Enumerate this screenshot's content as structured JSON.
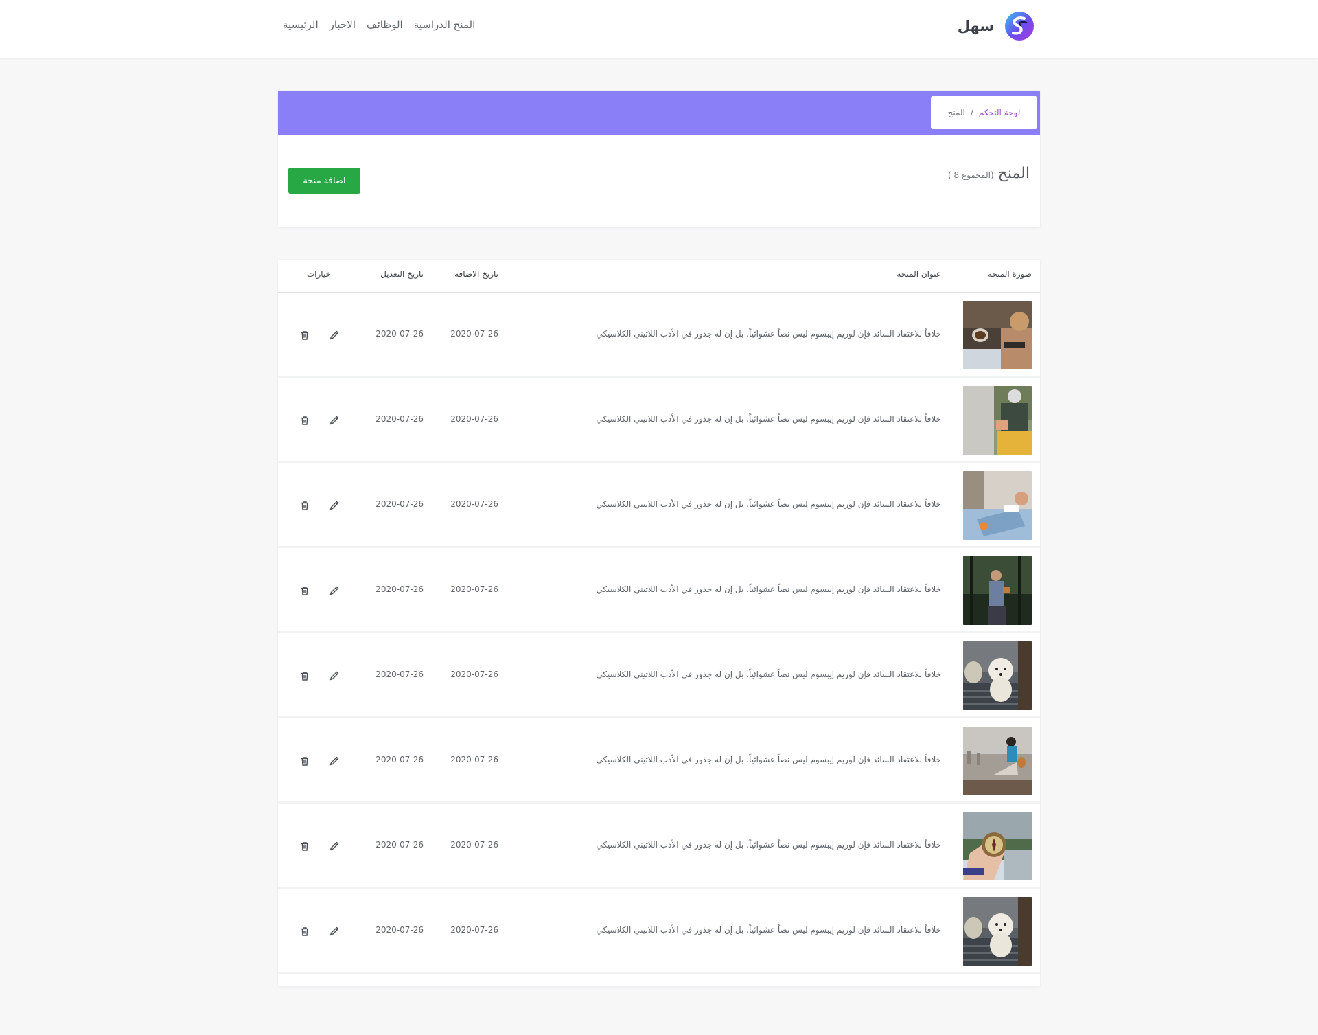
{
  "navbar": {
    "brand_name": "سهل",
    "links": [
      "الرئيسية",
      "الاخبار",
      "الوظائف",
      "المنح الدراسية"
    ]
  },
  "breadcrumb": {
    "items": [
      "لوحة التحكم",
      "المنح"
    ],
    "separator": "/"
  },
  "page": {
    "title": "المنح",
    "count_label": "(المجموع 8 )",
    "add_button": "اضافة منحة",
    "band_color": "#8b7ff7",
    "button_color": "#28a745"
  },
  "table": {
    "headers": {
      "image": "صورة المنحة",
      "title": "عنوان المنحة",
      "added": "تاريخ الاضافة",
      "edited": "تاريخ التعديل",
      "options": "خيارات"
    },
    "rows": [
      {
        "image": "desk-coffee-laptop-photo",
        "title": "خلافاً للاعتقاد السائد فإن لوريم إيبسوم ليس نصاً عشوائياً، بل إن له جذور في الأدب اللاتيني الكلاسيكي",
        "added": "2020-07-26",
        "edited": "2020-07-26"
      },
      {
        "image": "person-with-headphones-photo",
        "title": "خلافاً للاعتقاد السائد فإن لوريم إيبسوم ليس نصاً عشوائياً، بل إن له جذور في الأدب اللاتيني الكلاسيكي",
        "added": "2020-07-26",
        "edited": "2020-07-26"
      },
      {
        "image": "girl-reading-in-bed-photo",
        "title": "خلافاً للاعتقاد السائد فإن لوريم إيبسوم ليس نصاً عشوائياً، بل إن له جذور في الأدب اللاتيني الكلاسيكي",
        "added": "2020-07-26",
        "edited": "2020-07-26"
      },
      {
        "image": "man-with-camera-forest-photo",
        "title": "خلافاً للاعتقاد السائد فإن لوريم إيبسوم ليس نصاً عشوائياً، بل إن له جذور في الأدب اللاتيني الكلاسيكي",
        "added": "2020-07-26",
        "edited": "2020-07-26"
      },
      {
        "image": "white-dog-on-couch-photo",
        "title": "خلافاً للاعتقاد السائد فإن لوريم إيبسوم ليس نصاً عشوائياً، بل إن له جذور في الأدب اللاتيني الكلاسيكي",
        "added": "2020-07-26",
        "edited": "2020-07-26"
      },
      {
        "image": "woman-sitting-city-view-photo",
        "title": "خلافاً للاعتقاد السائد فإن لوريم إيبسوم ليس نصاً عشوائياً، بل إن له جذور في الأدب اللاتيني الكلاسيكي",
        "added": "2020-07-26",
        "edited": "2020-07-26"
      },
      {
        "image": "hand-holding-compass-photo",
        "title": "خلافاً للاعتقاد السائد فإن لوريم إيبسوم ليس نصاً عشوائياً، بل إن له جذور في الأدب اللاتيني الكلاسيكي",
        "added": "2020-07-26",
        "edited": "2020-07-26"
      },
      {
        "image": "white-dog-on-couch-photo",
        "title": "خلافاً للاعتقاد السائد فإن لوريم إيبسوم ليس نصاً عشوائياً، بل إن له جذور في الأدب اللاتيني الكلاسيكي",
        "added": "2020-07-26",
        "edited": "2020-07-26"
      }
    ]
  }
}
